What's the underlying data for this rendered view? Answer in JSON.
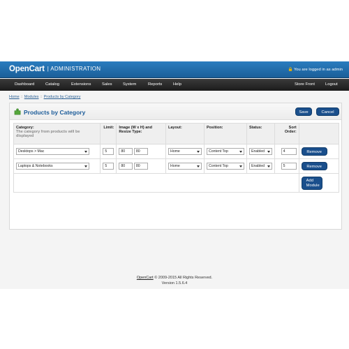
{
  "header": {
    "brand": "OpenCart",
    "brand_suffix": "ADMINISTRATION",
    "logged_in": "You are logged in as admin"
  },
  "nav": {
    "left": [
      "Dashboard",
      "Catalog",
      "Extensions",
      "Sales",
      "System",
      "Reports",
      "Help"
    ],
    "right": [
      "Store Front",
      "Logout"
    ]
  },
  "breadcrumb": [
    "Home",
    "Modules",
    "Products by Category"
  ],
  "panel": {
    "title": "Products by Category",
    "save_label": "Save",
    "cancel_label": "Cancel"
  },
  "table": {
    "headers": {
      "category": "Category:",
      "category_help": "The category from products will be displayed",
      "limit": "Limit:",
      "image": "Image (W x H) and Resize Type:",
      "layout": "Layout:",
      "position": "Position:",
      "status": "Status:",
      "sort": "Sort Order:"
    },
    "rows": [
      {
        "category": "Desktops > Mac",
        "limit": "5",
        "width": "80",
        "height": "80",
        "layout": "Home",
        "position": "Content Top",
        "status": "Enabled",
        "sort": "4",
        "remove": "Remove"
      },
      {
        "category": "Laptops & Notebooks",
        "limit": "5",
        "width": "80",
        "height": "80",
        "layout": "Home",
        "position": "Content Top",
        "status": "Enabled",
        "sort": "5",
        "remove": "Remove"
      }
    ],
    "add_module": "Add Module"
  },
  "footer": {
    "link": "OpenCart",
    "copyright": " © 2009-2015 All Rights Reserved.",
    "version": "Version 1.5.6.4"
  },
  "colors": {
    "header_blue": "#1b5f99",
    "button_blue": "#1a4f8c",
    "title_blue": "#1c5c99"
  }
}
